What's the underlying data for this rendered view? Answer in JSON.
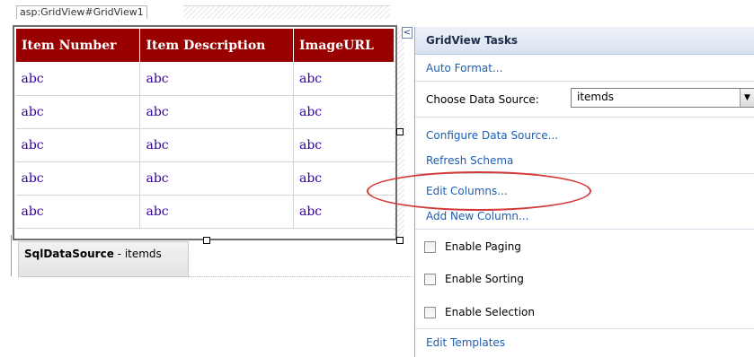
{
  "designer": {
    "control_tag": "asp:GridView#GridView1",
    "grid": {
      "headers": [
        "Item Number",
        "Item Description",
        "ImageURL"
      ],
      "rows": [
        [
          "abc",
          "abc",
          "abc"
        ],
        [
          "abc",
          "abc",
          "abc"
        ],
        [
          "abc",
          "abc",
          "abc"
        ],
        [
          "abc",
          "abc",
          "abc"
        ],
        [
          "abc",
          "abc",
          "abc"
        ]
      ]
    },
    "datasource_control": {
      "type": "SqlDataSource",
      "separator": " - ",
      "id": "itemds"
    }
  },
  "smart_tag": {
    "glyph": "<"
  },
  "tasks_panel": {
    "title": "GridView Tasks",
    "auto_format": "Auto Format...",
    "choose_source_label": "Choose Data Source:",
    "choose_source_value": "itemds",
    "configure": "Configure Data Source...",
    "refresh": "Refresh Schema",
    "edit_columns": "Edit Columns...",
    "add_column": "Add New Column...",
    "enable_paging": "Enable Paging",
    "enable_sorting": "Enable Sorting",
    "enable_selection": "Enable Selection",
    "edit_templates": "Edit Templates"
  },
  "colors": {
    "header_bg": "#990000",
    "cell_text": "#330099",
    "link": "#1c5eb3",
    "highlight_oval": "#d23a3a"
  }
}
